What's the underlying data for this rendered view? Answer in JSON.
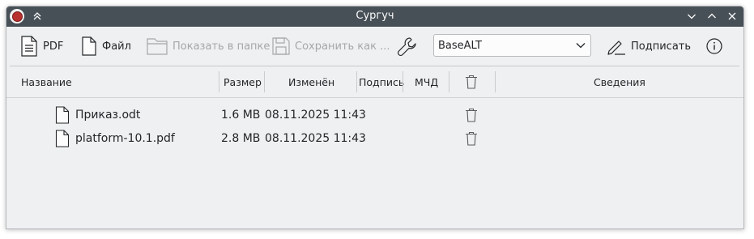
{
  "window": {
    "title": "Сургуч"
  },
  "toolbar": {
    "pdf_label": "PDF",
    "file_label": "Файл",
    "show_in_folder_label": "Показать в папке",
    "save_as_label": "Сохранить как ...",
    "profile_selected": "BaseALT",
    "sign_label": "Подписать"
  },
  "table": {
    "columns": {
      "name": "Название",
      "size": "Размер",
      "modified": "Изменён",
      "signature": "Подпись",
      "mchd": "МЧД",
      "details": "Сведения"
    },
    "rows": [
      {
        "name": "Приказ.odt",
        "size": "1.6 MB",
        "modified": "08.11.2025 11:43"
      },
      {
        "name": "platform-10.1.pdf",
        "size": "2.8 MB",
        "modified": "08.11.2025 11:43"
      }
    ]
  }
}
